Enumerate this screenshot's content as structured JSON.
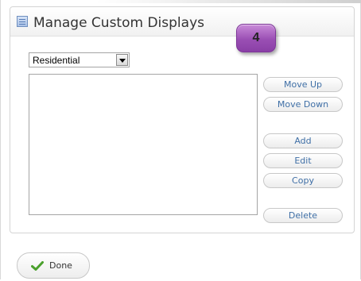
{
  "panel": {
    "title": "Manage Custom Displays",
    "icon": "window-icon"
  },
  "step_badge": "4",
  "display_select": {
    "selected": "Residential",
    "icon": "dropdown-arrow-icon"
  },
  "display_list": {
    "items": []
  },
  "buttons": {
    "move_up": "Move Up",
    "move_down": "Move Down",
    "add": "Add",
    "edit": "Edit",
    "copy": "Copy",
    "delete": "Delete"
  },
  "done_button": {
    "label": "Done",
    "icon": "checkmark-icon"
  },
  "colors": {
    "button_text": "#3f6fa6",
    "badge": "#9a4fb4",
    "checkmark": "#4aa02c"
  }
}
